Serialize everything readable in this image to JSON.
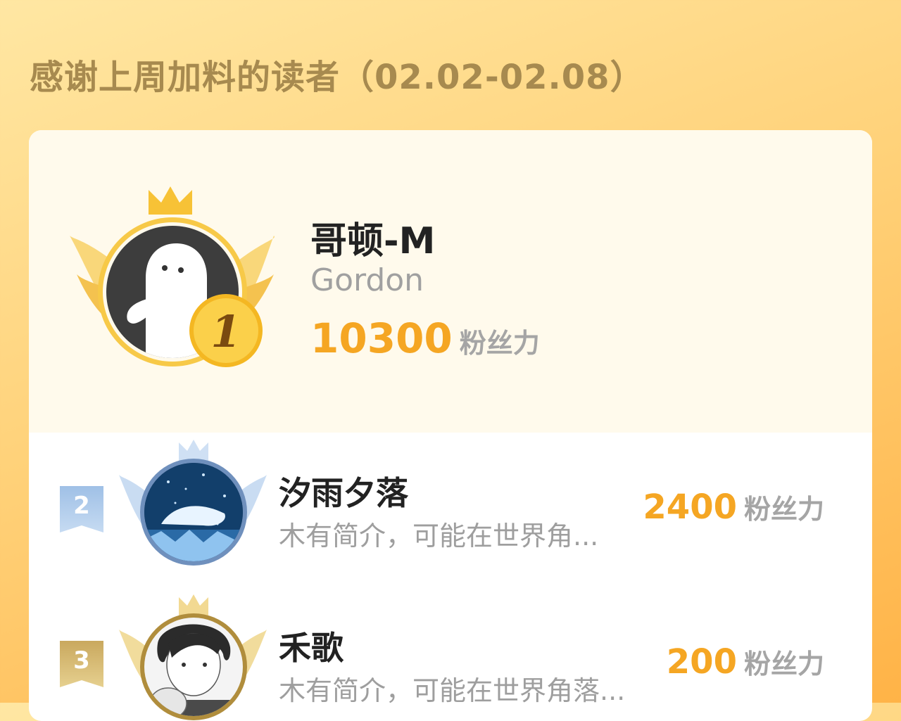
{
  "header": {
    "title": "感谢上周加料的读者（02.02-02.08）"
  },
  "colors": {
    "accent": "#f5a623",
    "gold": "#f7c948",
    "silver": "#9fbfe0",
    "bronze": "#d9b86a",
    "panel": "#fffaec"
  },
  "unit_label": "粉丝力",
  "top_reader": {
    "rank": "1",
    "name": "哥顿-M",
    "subtitle": "Gordon",
    "score": "10300",
    "avatar_icon": "white-ghost-avatar"
  },
  "readers": [
    {
      "rank": "2",
      "name": "汐雨夕落",
      "bio": "木有简介，可能在世界角...",
      "score": "2400",
      "avatar_icon": "night-sky-avatar"
    },
    {
      "rank": "3",
      "name": "禾歌",
      "bio": "木有简介，可能在世界角落...",
      "score": "200",
      "avatar_icon": "manga-boy-avatar"
    }
  ]
}
